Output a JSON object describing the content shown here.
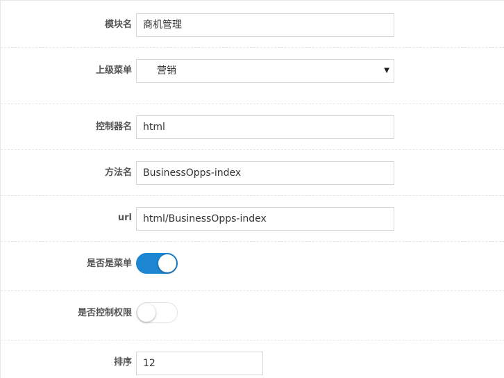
{
  "form": {
    "module_name": {
      "label": "模块名",
      "value": "商机管理"
    },
    "parent_menu": {
      "label": "上级菜单",
      "value": "营销"
    },
    "controller_name": {
      "label": "控制器名",
      "value": "html"
    },
    "method_name": {
      "label": "方法名",
      "value": "BusinessOpps-index"
    },
    "url": {
      "label": "url",
      "value": "html/BusinessOpps-index"
    },
    "is_menu": {
      "label": "是否是菜单",
      "checked": true
    },
    "permission_control": {
      "label": "是否控制权限",
      "checked": false
    },
    "sort": {
      "label": "排序",
      "value": "12"
    }
  },
  "icons": {
    "select_caret": "▼"
  },
  "colors": {
    "toggle_on": "#1c86d1",
    "divider": "#e4e4e4",
    "input_border": "#d7d7d7"
  }
}
